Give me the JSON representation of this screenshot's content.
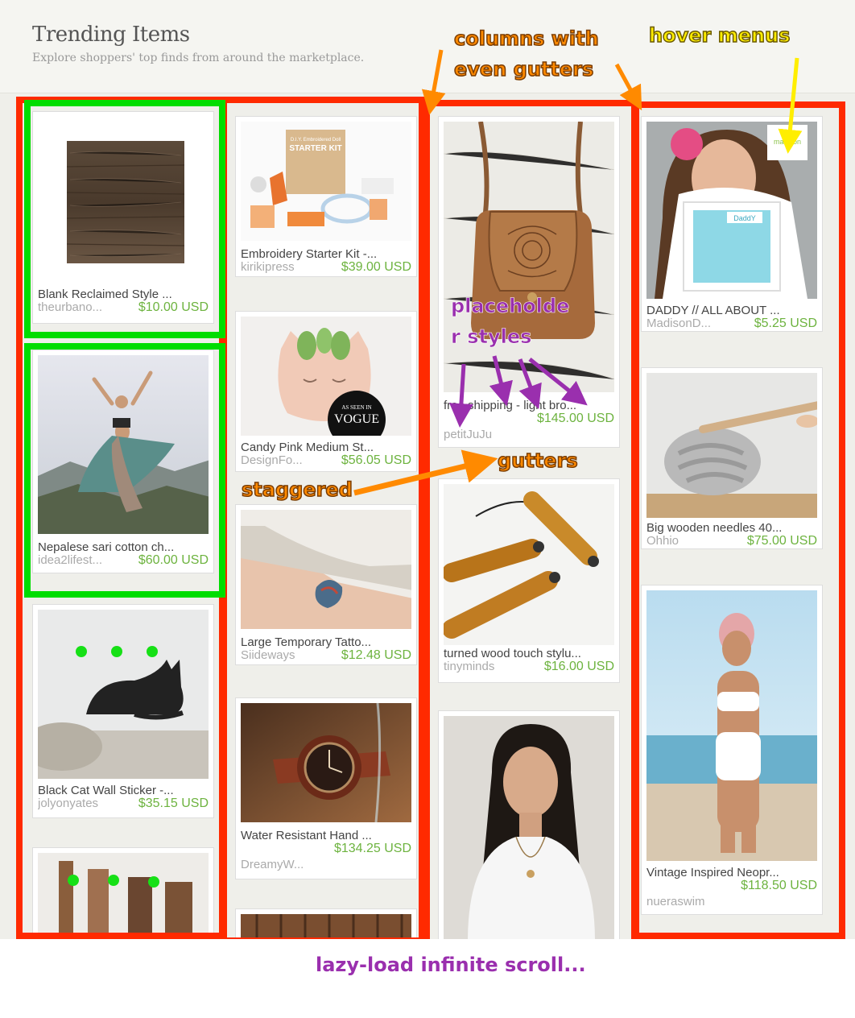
{
  "header": {
    "title": "Trending Items",
    "subtitle": "Explore shoppers' top finds from around the marketplace."
  },
  "cards": [
    {
      "title": "Blank Reclaimed Style ...",
      "shop": "theurbano...",
      "price": "$10.00 USD"
    },
    {
      "title": "Nepalese sari cotton ch...",
      "shop": "idea2lifest...",
      "price": "$60.00 USD"
    },
    {
      "title": "Black Cat Wall Sticker -...",
      "shop": "jolyonyates",
      "price": "$35.15 USD"
    },
    {
      "title": "",
      "shop": "",
      "price": ""
    },
    {
      "title": "Embroidery Starter Kit -...",
      "shop": "kirikipress",
      "price": "$39.00 USD"
    },
    {
      "title": "Candy Pink Medium St...",
      "shop": "DesignFo...",
      "price": "$56.05 USD"
    },
    {
      "title": "Large Temporary Tatto...",
      "shop": "Siideways",
      "price": "$12.48 USD"
    },
    {
      "title": "Water Resistant Hand ...",
      "shop": "DreamyW...",
      "price": "$134.25 USD"
    },
    {
      "title": "",
      "shop": "",
      "price": ""
    },
    {
      "title": "free shipping - light bro...",
      "shop": "petitJuJu",
      "price": "$145.00 USD"
    },
    {
      "title": "turned wood touch stylu...",
      "shop": "tinyminds",
      "price": "$16.00 USD"
    },
    {
      "title": "",
      "shop": "",
      "price": ""
    },
    {
      "title": "DADDY // ALL ABOUT ...",
      "shop": "MadisonD...",
      "price": "$5.25 USD"
    },
    {
      "title": "Big wooden needles 40...",
      "shop": "Ohhio",
      "price": "$75.00 USD"
    },
    {
      "title": "Vintage Inspired Neopr...",
      "shop": "nueraswim",
      "price": "$118.50 USD"
    }
  ],
  "image_labels": {
    "starter_kit_title": "D.I.Y. Embroidered Doll",
    "starter_kit_big": "STARTER KIT",
    "vogue_small": "AS SEEN IN",
    "vogue_big": "VOGUE",
    "daddy_sign": "DaddY"
  },
  "annotations": {
    "columns": "columns with",
    "columns2": "even gutters",
    "hover": "hover menus",
    "placeholder1": "placeholde",
    "placeholder2": "r styles",
    "gutters": "gutters",
    "staggered": "staggered",
    "lazy": "lazy-load infinite scroll..."
  },
  "colors": {
    "price": "#6db33f",
    "annotation_red": "#ff2a00",
    "annotation_green": "#00dd00",
    "annotation_orange": "#ff8a00",
    "annotation_yellow": "#ffee00",
    "annotation_purple": "#9a2fae"
  }
}
